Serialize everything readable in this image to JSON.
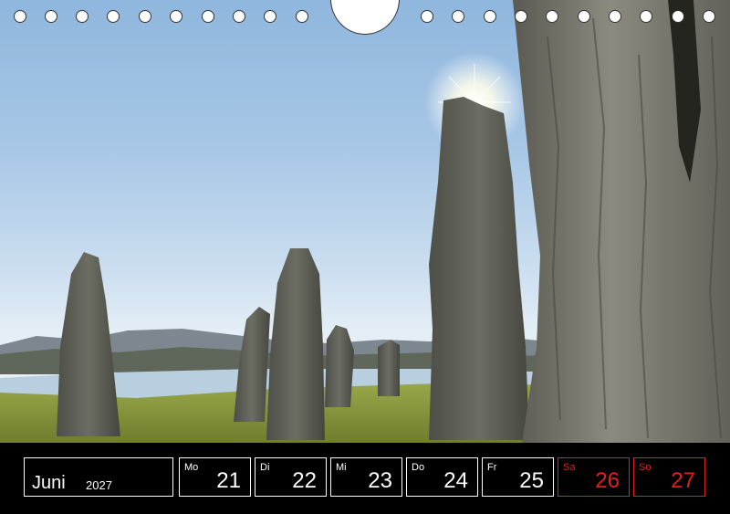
{
  "calendar": {
    "month": "Juni",
    "year": "2027",
    "days": [
      {
        "weekday": "Mo",
        "date": "21",
        "weekend": false
      },
      {
        "weekday": "Di",
        "date": "22",
        "weekend": false
      },
      {
        "weekday": "Mi",
        "date": "23",
        "weekend": false
      },
      {
        "weekday": "Do",
        "date": "24",
        "weekend": false
      },
      {
        "weekday": "Fr",
        "date": "25",
        "weekend": false
      },
      {
        "weekday": "Sa",
        "date": "26",
        "weekend": true
      },
      {
        "weekday": "So",
        "date": "27",
        "weekend": true
      }
    ]
  },
  "colors": {
    "weekend": "#e0201b",
    "bar": "#000000"
  }
}
